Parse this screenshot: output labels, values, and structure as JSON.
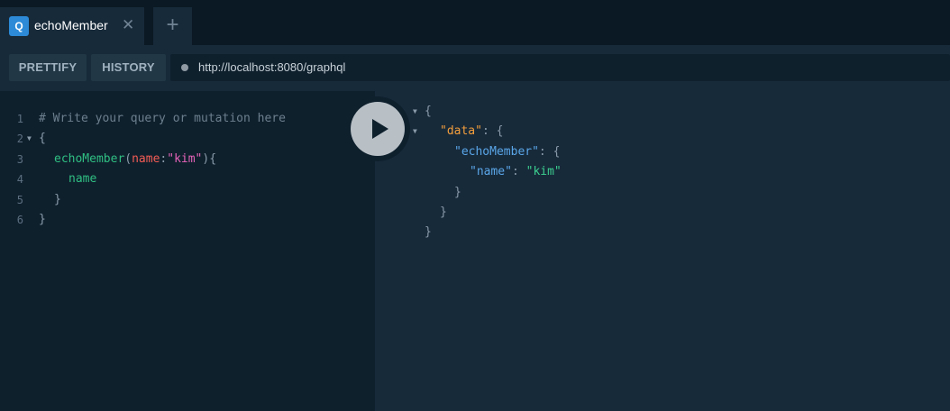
{
  "tabs": [
    {
      "badge": "Q",
      "title": "echoMember",
      "close": "✕"
    }
  ],
  "new_tab_label": "+",
  "toolbar": {
    "prettify_label": "PRETTIFY",
    "history_label": "HISTORY",
    "url": "http://localhost:8080/graphql"
  },
  "editor": {
    "line_numbers": [
      "1",
      "2",
      "3",
      "4",
      "5",
      "6"
    ],
    "comment": "# Write your query or mutation here",
    "open_brace": "{",
    "query_field": "echoMember",
    "open_paren": "(",
    "arg_name": "name",
    "colon": ":",
    "arg_value": "\"kim\"",
    "close_paren_brace": "){",
    "selection_field": "name",
    "close_inner": "}",
    "close_outer": "}"
  },
  "result": {
    "open": "{",
    "data_key": "\"data\"",
    "data_open": ": {",
    "member_key": "\"echoMember\"",
    "member_open": ": {",
    "name_key": "\"name\"",
    "name_sep": ": ",
    "name_value": "\"kim\"",
    "close_member": "}",
    "close_data": "}",
    "close_root": "}"
  },
  "colors": {
    "background": "#172a3a",
    "editor_background": "#0f202d",
    "field": "#2fbf82",
    "argument": "#f25c54",
    "string": "#e563b8",
    "result_key_data": "#f39e3c",
    "result_key": "#5aa6e8",
    "result_string": "#3ccf8f",
    "badge": "#2c8ad7"
  },
  "icons": {
    "run": "play-icon",
    "fold": "caret-down-icon",
    "close": "close-icon",
    "status": "status-dot"
  }
}
